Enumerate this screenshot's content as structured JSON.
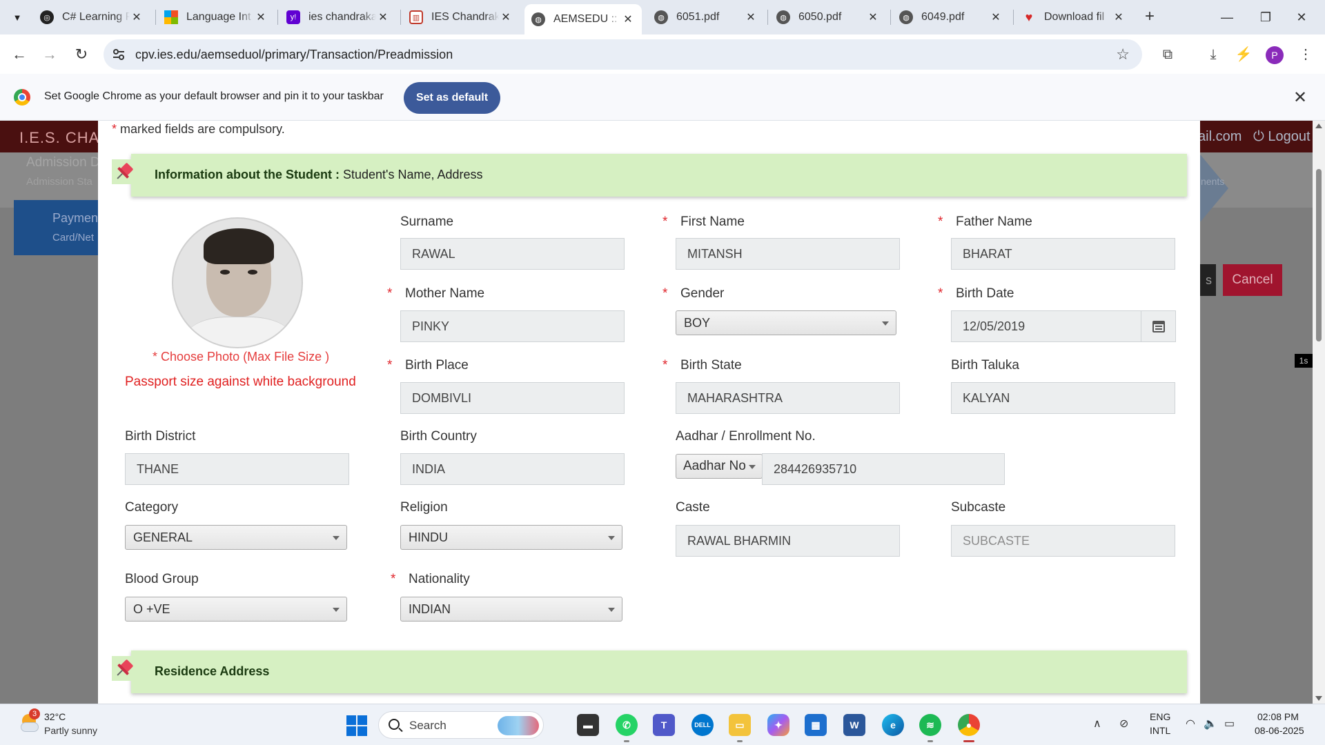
{
  "browser": {
    "tabs": [
      {
        "title": "C# Learning P",
        "icon": "openai-icon",
        "color": "#222222"
      },
      {
        "title": "Language Int",
        "icon": "microsoft-icon",
        "color": "#f25022"
      },
      {
        "title": "ies chandraka",
        "icon": "yahoo-icon",
        "color": "#6001d2"
      },
      {
        "title": "IES Chandrak",
        "icon": "ies-icon",
        "color": "#c0392b"
      },
      {
        "title": "AEMSEDU :: P",
        "icon": "globe-icon",
        "color": "#555555"
      },
      {
        "title": "6051.pdf",
        "icon": "globe-icon",
        "color": "#555555"
      },
      {
        "title": "6050.pdf",
        "icon": "globe-icon",
        "color": "#555555"
      },
      {
        "title": "6049.pdf",
        "icon": "globe-icon",
        "color": "#555555"
      },
      {
        "title": "Download fil",
        "icon": "heart-icon",
        "color": "#d62828"
      }
    ],
    "url": "cpv.ies.edu/aemseduol/primary/Transaction/Preadmission",
    "profile_initial": "P",
    "infobar_message": "Set Google Chrome as your default browser and pin it to your taskbar",
    "infobar_button": "Set as default"
  },
  "background_page": {
    "brand": "I.E.S. CHAN",
    "mail_fragment": "ail.com",
    "logout": "Logout",
    "admission_title": "Admission D",
    "admission_sub": "Admission Sta",
    "payment_title": "Paymen",
    "payment_sub": "Card/Net",
    "steps_fragment": "nents",
    "dark_button_fragment": "s",
    "cancel_button": "Cancel",
    "chip": "1s"
  },
  "form": {
    "compulsory_note": "marked fields are compulsory.",
    "required_mark": "*",
    "section_student": {
      "title": "Information about the Student :",
      "subtitle": "Student's Name, Address"
    },
    "section_residence": {
      "title": "Residence Address"
    },
    "photo": {
      "choose_label": "* Choose Photo (Max File Size )",
      "hint": "Passport size against white background"
    },
    "surname": {
      "label": "Surname",
      "value": "RAWAL"
    },
    "first_name": {
      "label": "First Name",
      "value": "MITANSH"
    },
    "father_name": {
      "label": "Father Name",
      "value": "BHARAT"
    },
    "mother_name": {
      "label": "Mother Name",
      "value": "PINKY"
    },
    "gender": {
      "label": "Gender",
      "value": "BOY"
    },
    "birth_date": {
      "label": "Birth Date",
      "value": "12/05/2019"
    },
    "birth_place": {
      "label": "Birth Place",
      "value": "DOMBIVLI"
    },
    "birth_state": {
      "label": "Birth State",
      "value": "MAHARASHTRA"
    },
    "birth_taluka": {
      "label": "Birth Taluka",
      "value": "KALYAN"
    },
    "birth_district": {
      "label": "Birth District",
      "value": "THANE"
    },
    "birth_country": {
      "label": "Birth Country",
      "value": "INDIA"
    },
    "aadhar": {
      "label": "Aadhar / Enrollment No.",
      "type": "Aadhar No",
      "value": "284426935710"
    },
    "category": {
      "label": "Category",
      "value": "GENERAL"
    },
    "religion": {
      "label": "Religion",
      "value": "HINDU"
    },
    "caste": {
      "label": "Caste",
      "value": "RAWAL BHARMIN"
    },
    "subcaste": {
      "label": "Subcaste",
      "placeholder": "SUBCASTE"
    },
    "blood_group": {
      "label": "Blood Group",
      "value": "O +VE"
    },
    "nationality": {
      "label": "Nationality",
      "value": "INDIAN"
    }
  },
  "taskbar": {
    "weather_temp": "32°C",
    "weather_desc": "Partly sunny",
    "weather_badge": "3",
    "search_label": "Search",
    "lang_line1": "ENG",
    "lang_line2": "INTL",
    "time": "02:08 PM",
    "date": "08-06-2025"
  },
  "colors": {
    "section_bg": "#d6f0c2",
    "required": "#e0242b",
    "cancel": "#a0142e",
    "set_default": "#3c5a9a"
  }
}
